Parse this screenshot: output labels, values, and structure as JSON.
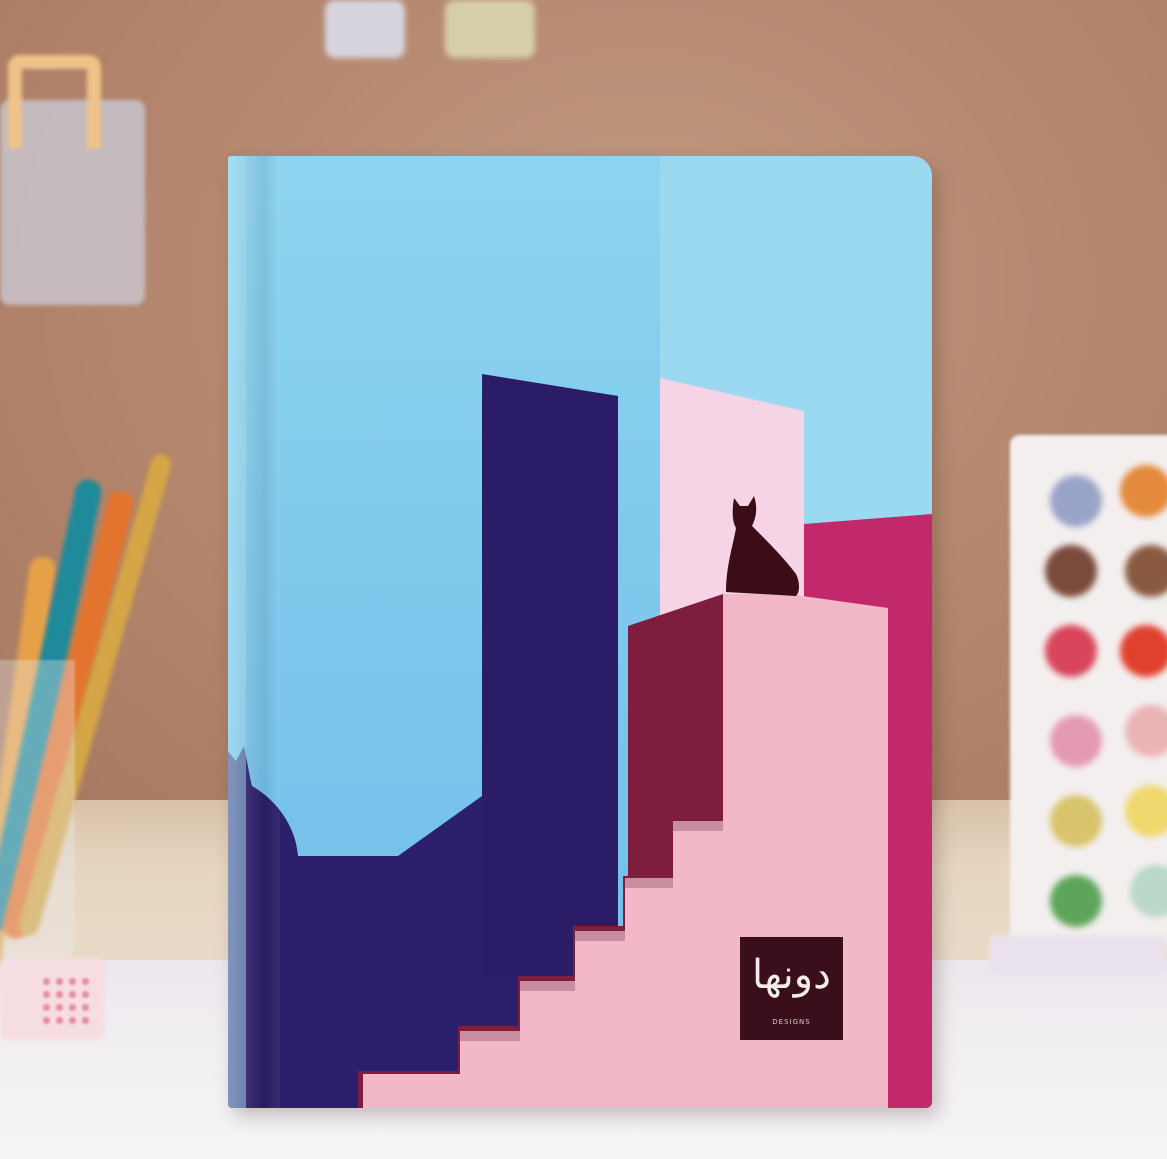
{
  "scene": {
    "colors": {
      "sky_light": "#8fd3ee",
      "sky_mid": "#72c4ec",
      "navy": "#2c1f6b",
      "navy_dark": "#241957",
      "pink_light": "#f2b7c7",
      "pink_wall": "#f7d2e4",
      "magenta": "#c02a6b",
      "maroon": "#7a1c3a",
      "cat": "#3b0d18"
    },
    "logo": {
      "text": "دونها",
      "subtitle": "DESIGNS"
    },
    "icons": [
      "cat-silhouette-icon",
      "pens",
      "sticker-sheet",
      "washi-tape"
    ]
  }
}
